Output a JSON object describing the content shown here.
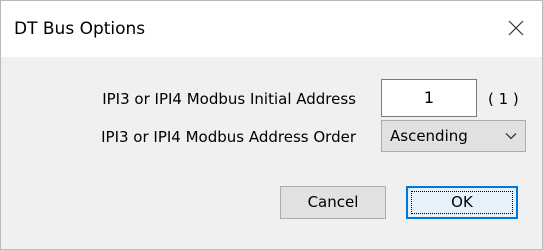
{
  "window": {
    "title": "DT Bus Options"
  },
  "form": {
    "initial_address_label": "IPI3 or IPI4 Modbus Initial Address",
    "initial_address_value": "1",
    "initial_address_hint": "( 1 )",
    "address_order_label": "IPI3 or IPI4 Modbus Address Order",
    "address_order_selected": "Ascending"
  },
  "buttons": {
    "cancel_label": "Cancel",
    "ok_label": "OK"
  },
  "icons": {
    "close": "close-icon",
    "dropdown": "chevron-down-icon"
  },
  "colors": {
    "accent": "#0078d7",
    "button_face": "#e1e1e1",
    "dialog_background": "#f0f0f0"
  }
}
